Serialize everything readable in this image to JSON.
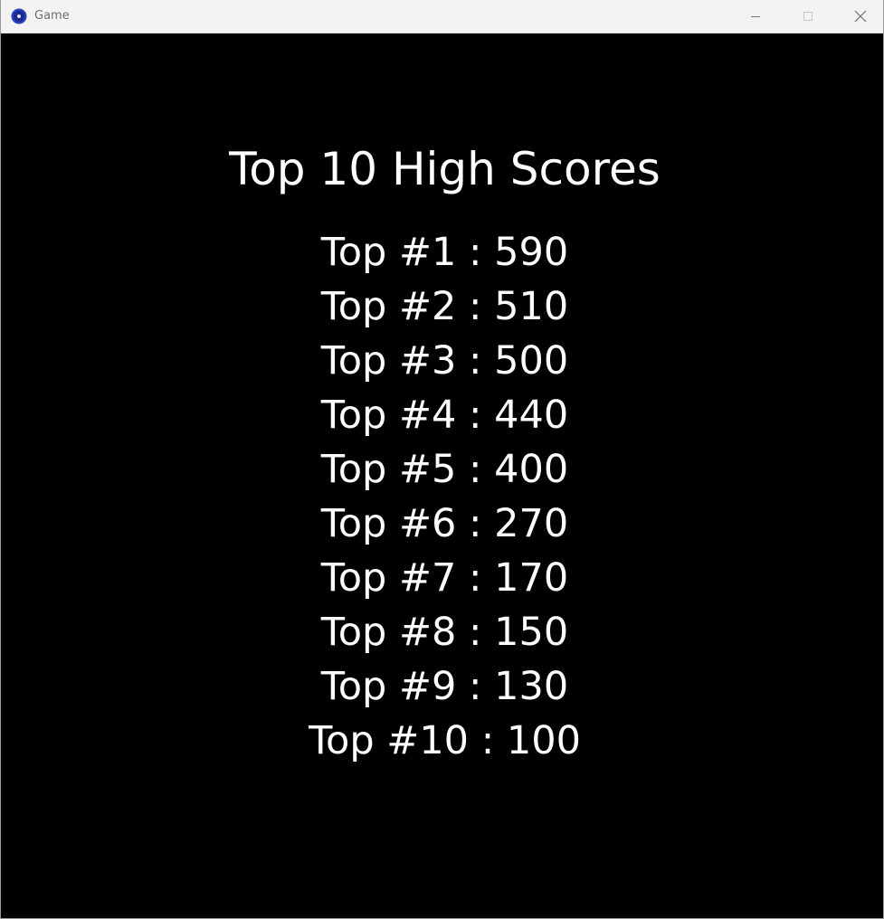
{
  "window": {
    "title": "Game",
    "icon": "app-disc-icon",
    "accent": "#2b3fb8"
  },
  "controls": {
    "minimize_icon": "minimize-icon",
    "maximize_icon": "maximize-icon",
    "close_icon": "close-icon"
  },
  "screen": {
    "heading": "Top 10 High Scores",
    "background": "#000000",
    "text_color": "#ffffff",
    "scores": [
      "Top #1 : 590",
      "Top #2 : 510",
      "Top #3 : 500",
      "Top #4 : 440",
      "Top #5 : 400",
      "Top #6 : 270",
      "Top #7 : 170",
      "Top #8 : 150",
      "Top #9 : 130",
      "Top #10 : 100"
    ]
  }
}
